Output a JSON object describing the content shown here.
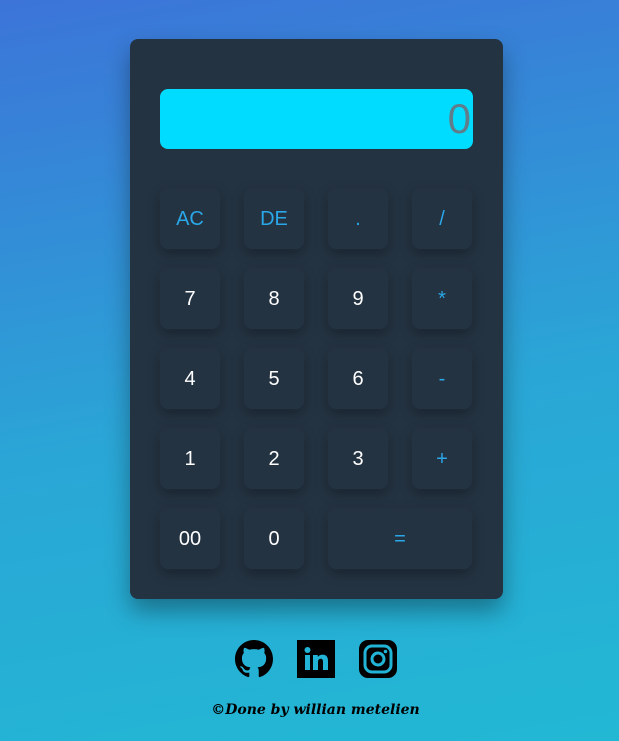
{
  "display": {
    "value": "0"
  },
  "keys": {
    "ac": "AC",
    "de": "DE",
    "dot": ".",
    "divide": "/",
    "seven": "7",
    "eight": "8",
    "nine": "9",
    "multiply": "*",
    "four": "4",
    "five": "5",
    "six": "6",
    "minus": "-",
    "one": "1",
    "two": "2",
    "three": "3",
    "plus": "+",
    "double_zero": "00",
    "zero": "0",
    "equals": "="
  },
  "social": {
    "icons": [
      "github-icon",
      "linkedin-icon",
      "instagram-icon"
    ]
  },
  "footer": {
    "credit": "©Done by willian metelien"
  },
  "colors": {
    "background_top": "#3c74d8",
    "background_bottom": "#22b8d4",
    "calculator_body": "#243342",
    "display_bg": "#00dcff",
    "display_text": "#607d8b",
    "operator_text": "#2aa7e8",
    "digit_text": "#ffffff"
  }
}
